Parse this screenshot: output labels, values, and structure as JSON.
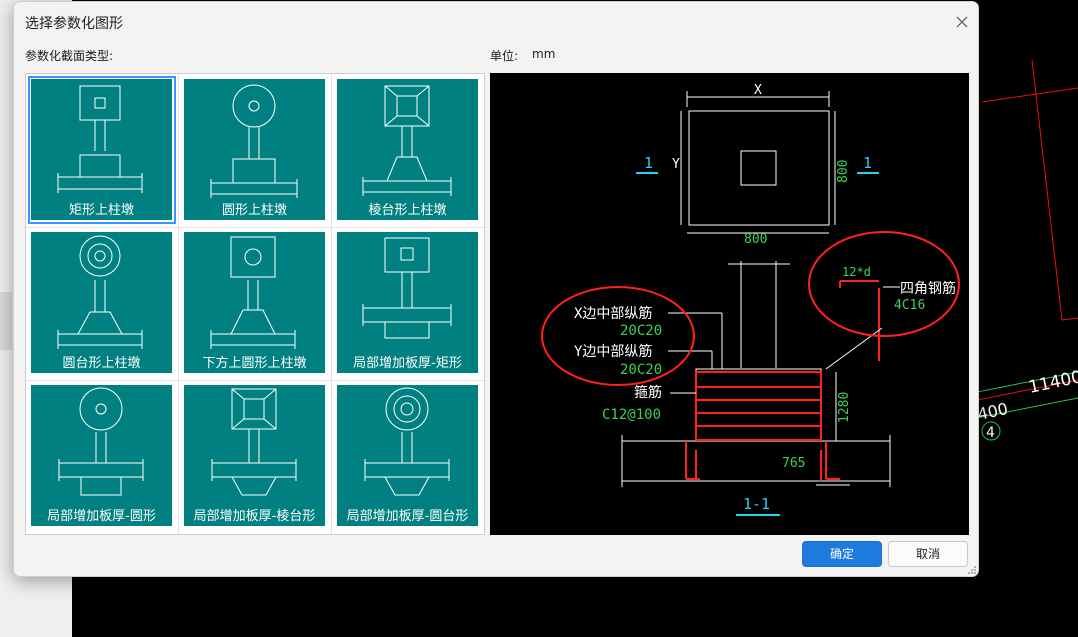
{
  "dialog": {
    "title": "选择参数化图形",
    "section_label": "参数化截面类型:",
    "unit_label": "单位:",
    "unit_value": "mm",
    "ok_label": "确定",
    "cancel_label": "取消"
  },
  "shapes": [
    {
      "label": "矩形上柱墩",
      "icon": "rect-pier-icon",
      "selected": true
    },
    {
      "label": "圆形上柱墩",
      "icon": "round-pier-icon"
    },
    {
      "label": "棱台形上柱墩",
      "icon": "frustum-pier-icon"
    },
    {
      "label": "圆台形上柱墩",
      "icon": "round-frustum-pier-icon"
    },
    {
      "label": "下方上圆形上柱墩",
      "icon": "square-round-pier-icon"
    },
    {
      "label": "局部增加板厚-矩形",
      "icon": "thicken-rect-icon"
    },
    {
      "label": "局部增加板厚-圆形",
      "icon": "thicken-round-icon"
    },
    {
      "label": "局部增加板厚-棱台形",
      "icon": "thicken-frustum-icon"
    },
    {
      "label": "局部增加板厚-圆台形",
      "icon": "thicken-round-frustum-icon"
    }
  ],
  "preview": {
    "dim_x": "X",
    "dim_y": "Y",
    "dim_width": "800",
    "dim_height": "800",
    "section_mark": "1",
    "section_title": "1-1",
    "label_x_rebar": "X边中部纵筋",
    "value_x_rebar": "20C20",
    "label_y_rebar": "Y边中部纵筋",
    "value_y_rebar": "20C20",
    "label_stirrup": "箍筋",
    "value_stirrup": "C12@100",
    "label_corner_rebar": "四角钢筋",
    "value_corner_rebar": "4C16",
    "anchor_len": "12*d",
    "dim_pier_height": "1280",
    "dim_offset": "765"
  },
  "background": {
    "dim_1": "11400",
    "dim_2": "400",
    "axis_tag": "4"
  },
  "colors": {
    "tile": "#008080",
    "accent": "#1f7ae0",
    "cad_green": "#39d353",
    "cad_red": "#ff2020",
    "cad_cyan": "#22d3ee"
  }
}
